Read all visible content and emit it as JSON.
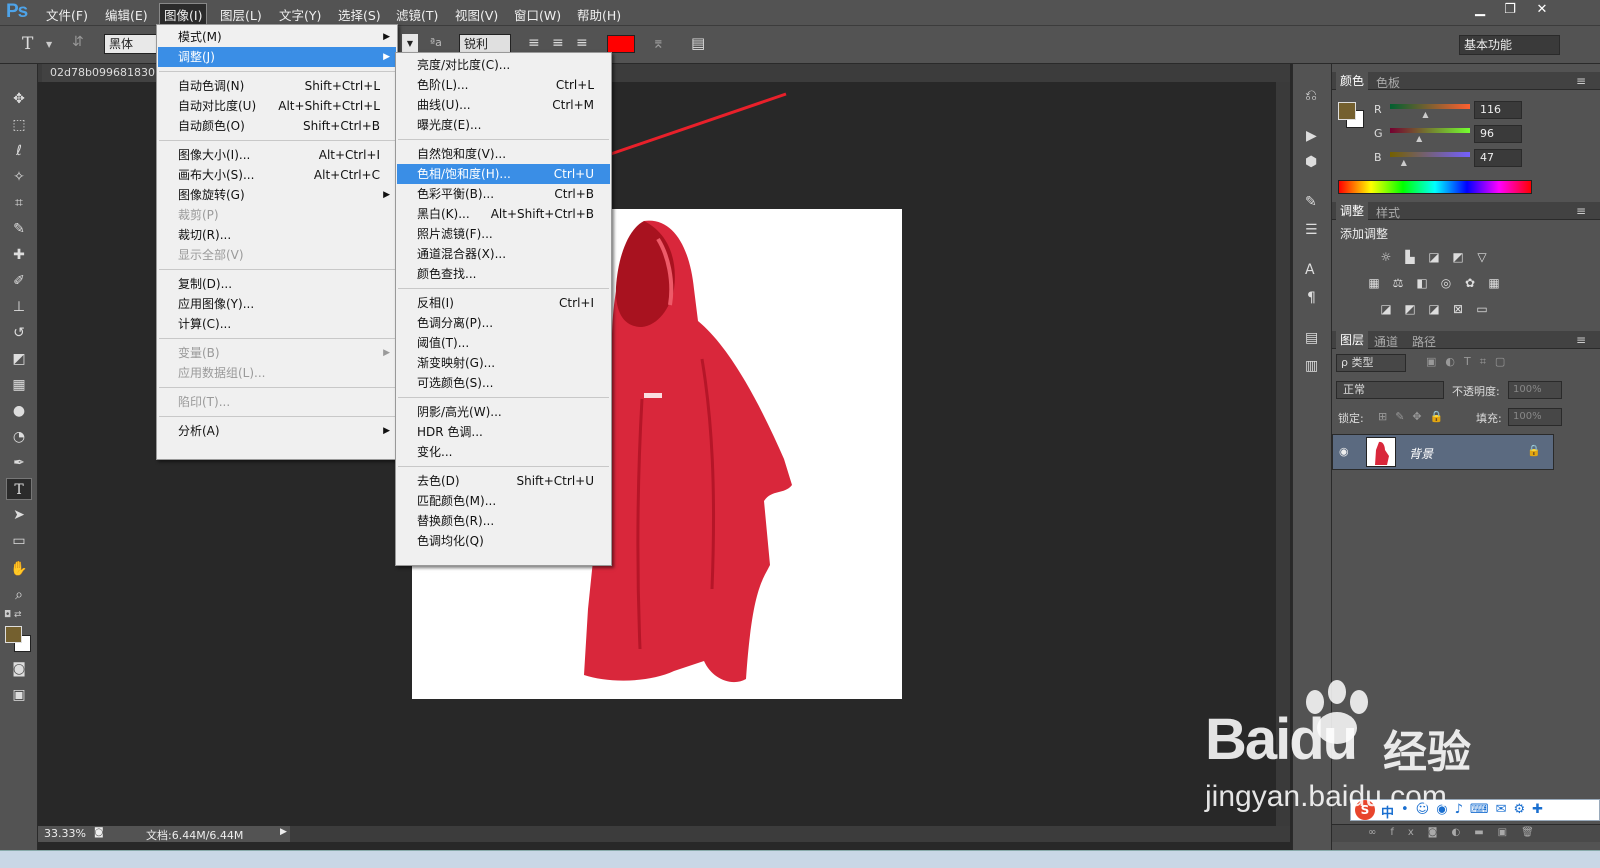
{
  "app": {
    "logo": "Ps"
  },
  "menubar": {
    "items": [
      "文件(F)",
      "编辑(E)",
      "图像(I)",
      "图层(L)",
      "文字(Y)",
      "选择(S)",
      "滤镜(T)",
      "视图(V)",
      "窗口(W)",
      "帮助(H)"
    ],
    "active_index": 2
  },
  "window_buttons": [
    "▁",
    "❐",
    "✕"
  ],
  "options": {
    "tool_icon": "T",
    "font_family": "黑体",
    "aa_label": "ªa",
    "aa_value": "锐利",
    "color": "#ff0000",
    "workspace": "基本功能"
  },
  "document": {
    "tab": "02d78b099681830",
    "zoom": "33.33%",
    "doc_info": "文档:6.44M/6.44M"
  },
  "image_menu": {
    "items": [
      {
        "label": "模式(M)",
        "shortcut": "",
        "submenu": true,
        "disabled": false
      },
      {
        "label": "调整(J)",
        "shortcut": "",
        "submenu": true,
        "disabled": false,
        "highlight": true
      },
      {
        "sep": true
      },
      {
        "label": "自动色调(N)",
        "shortcut": "Shift+Ctrl+L"
      },
      {
        "label": "自动对比度(U)",
        "shortcut": "Alt+Shift+Ctrl+L"
      },
      {
        "label": "自动颜色(O)",
        "shortcut": "Shift+Ctrl+B"
      },
      {
        "sep": true
      },
      {
        "label": "图像大小(I)...",
        "shortcut": "Alt+Ctrl+I"
      },
      {
        "label": "画布大小(S)...",
        "shortcut": "Alt+Ctrl+C"
      },
      {
        "label": "图像旋转(G)",
        "shortcut": "",
        "submenu": true
      },
      {
        "label": "裁剪(P)",
        "shortcut": "",
        "disabled": true
      },
      {
        "label": "裁切(R)...",
        "shortcut": ""
      },
      {
        "label": "显示全部(V)",
        "shortcut": "",
        "disabled": true
      },
      {
        "sep": true
      },
      {
        "label": "复制(D)...",
        "shortcut": ""
      },
      {
        "label": "应用图像(Y)...",
        "shortcut": ""
      },
      {
        "label": "计算(C)...",
        "shortcut": ""
      },
      {
        "sep": true
      },
      {
        "label": "变量(B)",
        "shortcut": "",
        "submenu": true,
        "disabled": true
      },
      {
        "label": "应用数据组(L)...",
        "shortcut": "",
        "disabled": true
      },
      {
        "sep": true
      },
      {
        "label": "陷印(T)...",
        "shortcut": "",
        "disabled": true
      },
      {
        "sep": true
      },
      {
        "label": "分析(A)",
        "shortcut": "",
        "submenu": true
      }
    ]
  },
  "adjust_menu": {
    "items": [
      {
        "label": "亮度/对比度(C)...",
        "shortcut": ""
      },
      {
        "label": "色阶(L)...",
        "shortcut": "Ctrl+L"
      },
      {
        "label": "曲线(U)...",
        "shortcut": "Ctrl+M"
      },
      {
        "label": "曝光度(E)...",
        "shortcut": ""
      },
      {
        "sep": true
      },
      {
        "label": "自然饱和度(V)...",
        "shortcut": ""
      },
      {
        "label": "色相/饱和度(H)...",
        "shortcut": "Ctrl+U",
        "highlight": true
      },
      {
        "label": "色彩平衡(B)...",
        "shortcut": "Ctrl+B"
      },
      {
        "label": "黑白(K)...",
        "shortcut": "Alt+Shift+Ctrl+B"
      },
      {
        "label": "照片滤镜(F)...",
        "shortcut": ""
      },
      {
        "label": "通道混合器(X)...",
        "shortcut": ""
      },
      {
        "label": "颜色查找...",
        "shortcut": ""
      },
      {
        "sep": true
      },
      {
        "label": "反相(I)",
        "shortcut": "Ctrl+I"
      },
      {
        "label": "色调分离(P)...",
        "shortcut": ""
      },
      {
        "label": "阈值(T)...",
        "shortcut": ""
      },
      {
        "label": "渐变映射(G)...",
        "shortcut": ""
      },
      {
        "label": "可选颜色(S)...",
        "shortcut": ""
      },
      {
        "sep": true
      },
      {
        "label": "阴影/高光(W)...",
        "shortcut": ""
      },
      {
        "label": "HDR 色调...",
        "shortcut": ""
      },
      {
        "label": "变化...",
        "shortcut": ""
      },
      {
        "sep": true
      },
      {
        "label": "去色(D)",
        "shortcut": "Shift+Ctrl+U"
      },
      {
        "label": "匹配颜色(M)...",
        "shortcut": ""
      },
      {
        "label": "替换颜色(R)...",
        "shortcut": ""
      },
      {
        "label": "色调均化(Q)",
        "shortcut": ""
      }
    ]
  },
  "color_panel": {
    "tabs": [
      "颜色",
      "色板"
    ],
    "channels": [
      {
        "name": "R",
        "value": "116",
        "fraction": 0.455
      },
      {
        "name": "G",
        "value": "96",
        "fraction": 0.376
      },
      {
        "name": "B",
        "value": "47",
        "fraction": 0.184
      }
    ],
    "foreground": "#74602f"
  },
  "adjust_panel": {
    "tabs": [
      "调整",
      "样式"
    ],
    "title": "添加调整"
  },
  "layers_panel": {
    "tabs": [
      "图层",
      "通道",
      "路径"
    ],
    "filter": "ρ 类型",
    "blend_mode": "正常",
    "opacity_label": "不透明度:",
    "opacity": "100%",
    "lock_label": "锁定:",
    "fill_label": "填充:",
    "fill": "100%",
    "layer_name": "背景"
  },
  "watermark": {
    "brand": "Baidu",
    "suffix": "经验",
    "url": "jingyan.baidu.com"
  },
  "ime": {
    "label": "中"
  }
}
